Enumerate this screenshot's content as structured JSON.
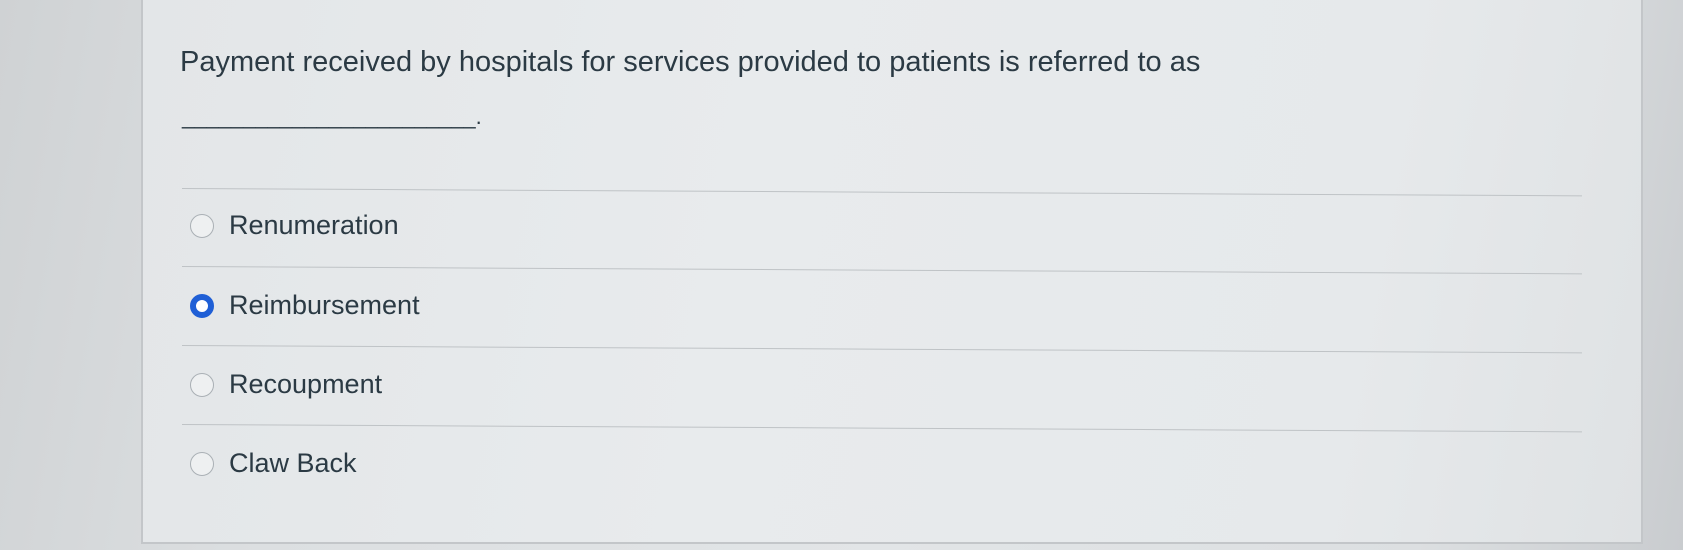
{
  "question": {
    "text": "Payment received by hospitals for services provided to patients is referred to as",
    "blank": "________________________."
  },
  "options": [
    {
      "label": "Renumeration",
      "selected": false
    },
    {
      "label": "Reimbursement",
      "selected": true
    },
    {
      "label": "Recoupment",
      "selected": false
    },
    {
      "label": "Claw Back",
      "selected": false
    }
  ]
}
